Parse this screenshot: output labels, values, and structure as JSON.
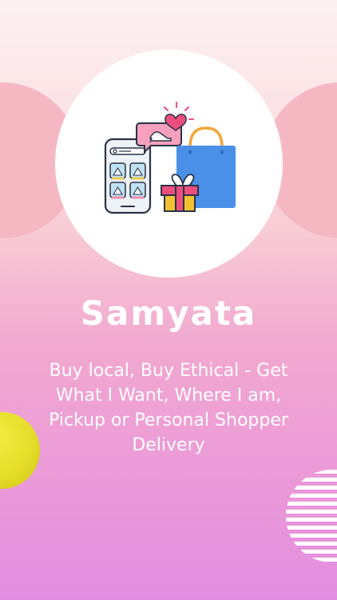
{
  "app": {
    "title": "Samyata",
    "tagline": "Buy local, Buy Ethical - Get What I Want, Where I am, Pickup or Personal Shopper Delivery"
  },
  "colors": {
    "background_top": "#fdf1f1",
    "background_bottom": "#e38de0",
    "side_circles": "#f5b8c3",
    "hero_circle": "#ffffff",
    "yellow_accent": "#e5de2a",
    "text": "#ffffff"
  },
  "icons": {
    "hero": "shopping-illustration",
    "phone": "smartphone-icon",
    "chat_bubble": "chat-bubble-icon",
    "heart": "heart-icon",
    "high_heel": "high-heel-shoe-icon",
    "bag": "shopping-bag-icon",
    "gift": "gift-box-icon"
  }
}
